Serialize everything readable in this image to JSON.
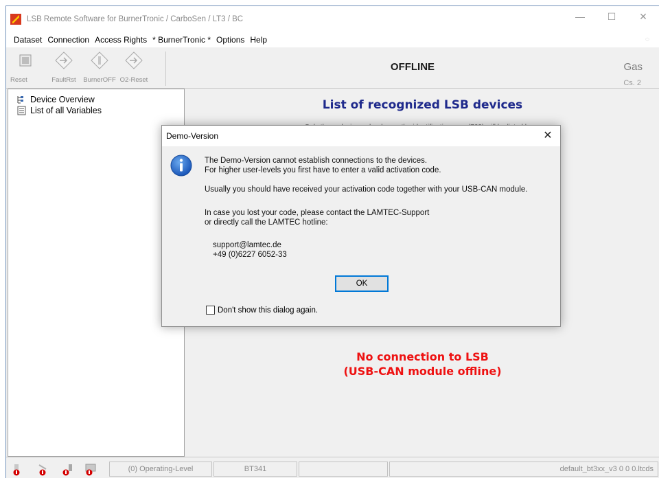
{
  "window": {
    "title": "LSB Remote Software for BurnerTronic / CarboSen / LT3 / BC",
    "controls": {
      "minimize": "—",
      "maximize": "☐",
      "close": "✕"
    }
  },
  "menu": {
    "items": [
      "Dataset",
      "Connection",
      "Access Rights",
      "* BurnerTronic *",
      "Options",
      "Help"
    ]
  },
  "toolbar": {
    "reset": "Reset",
    "faultrst": "FaultRst",
    "burneroff": "BurnerOFF",
    "o2reset": "O2-Reset",
    "status": "OFFLINE",
    "gas": "Gas",
    "cs": "Cs. 2"
  },
  "tree": {
    "items": [
      "Device Overview",
      "List of all Variables"
    ]
  },
  "content": {
    "title": "List of recognized LSB devices",
    "subtitle": "Only those devices who do use the identification-mso (768) will be listed here.",
    "noconn_line1": "No connection to LSB",
    "noconn_line2": "(USB-CAN module offline)"
  },
  "dialog": {
    "title": "Demo-Version",
    "close": "✕",
    "line1": "The Demo-Version cannot establish connections to the devices.",
    "line2": "For higher user-levels you first have to enter a valid activation code.",
    "line3": "Usually you should have received your activation code together with your USB-CAN module.",
    "line4": "In case you lost your code, please contact the LAMTEC-Support",
    "line5": "or directly call the LAMTEC hotline:",
    "email": "support@lamtec.de",
    "phone": "+49 (0)6227 6052-33",
    "ok": "OK",
    "checkbox": "Don't show this dialog again."
  },
  "statusbar": {
    "level": "(0) Operating-Level",
    "device": "BT341",
    "file": "default_bt3xx_v3 0 0 0.ltcds"
  },
  "colors": {
    "accent": "#0078d7",
    "title_blue": "#1f2a8c",
    "error_red": "#ee1111"
  }
}
